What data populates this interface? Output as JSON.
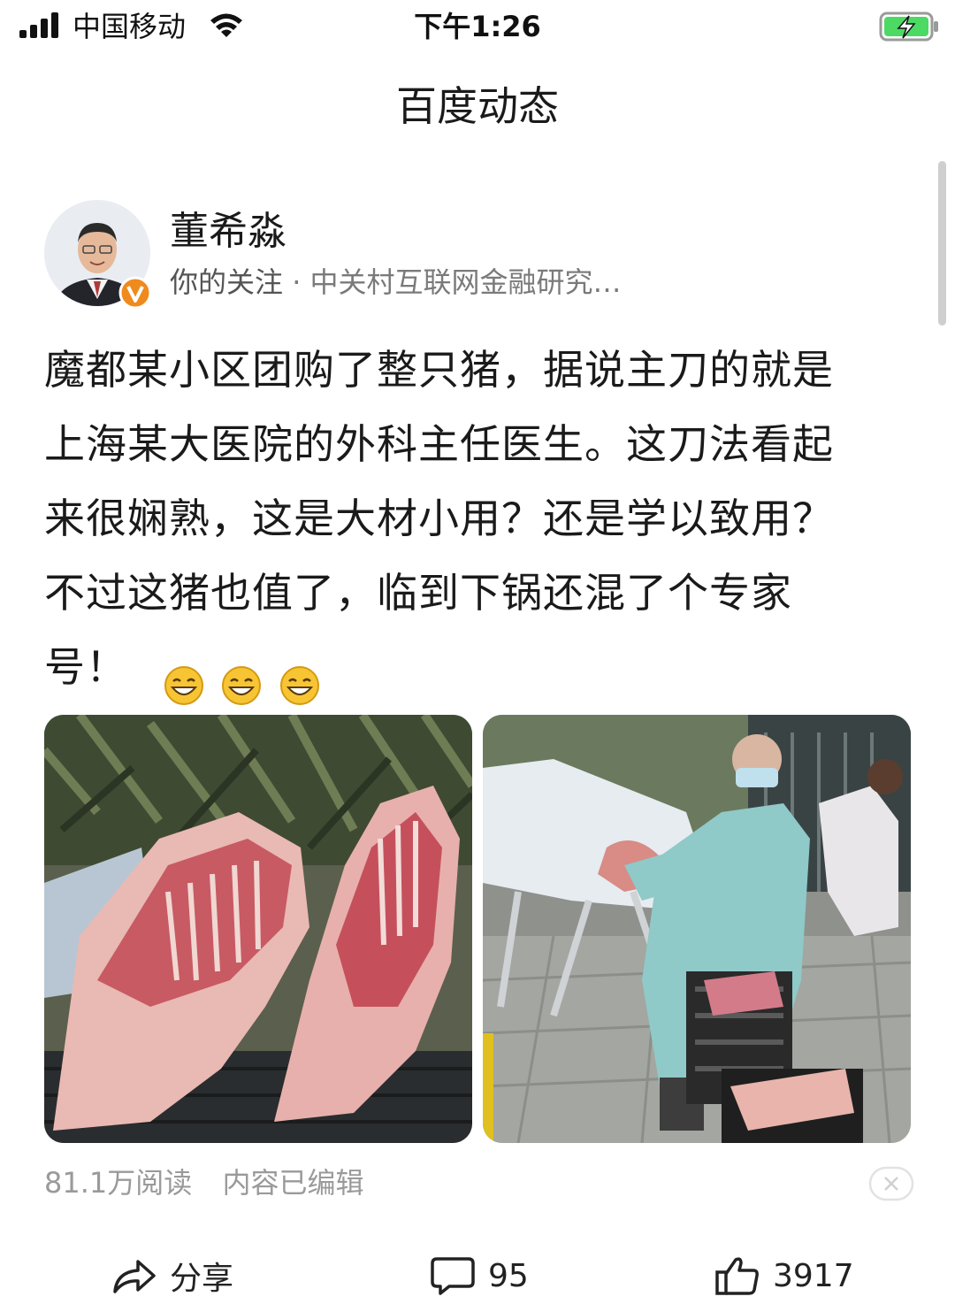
{
  "status_bar": {
    "carrier": "中国移动",
    "time": "下午1:26",
    "icons": [
      "signal-icon",
      "wifi-icon",
      "battery-charging-icon"
    ]
  },
  "header": {
    "title": "百度动态"
  },
  "author": {
    "name": "董希淼",
    "follow_status": "你的关注",
    "separator": "·",
    "affiliation": "中关村互联网金融研究…",
    "badge": "v",
    "badge_color": "#f08a1c"
  },
  "post": {
    "lines": [
      "魔都某小区团购了整只猪，据说主刀的就是",
      "上海某大医院的外科主任医生。这刀法看起",
      "来很娴熟，这是大材小用？还是学以致用？",
      "不过这猪也值了，临到下锅还混了个专家",
      "号！"
    ],
    "emoji_name": "grinning-face-icon",
    "emoji_count": 3,
    "images": [
      "pork-carcass-photo",
      "surgeon-cutting-pork-photo"
    ]
  },
  "stats": {
    "reads": "81.1万阅读",
    "edited": "内容已编辑"
  },
  "actions": {
    "share_label": "分享",
    "comments": "95",
    "likes": "3917"
  }
}
